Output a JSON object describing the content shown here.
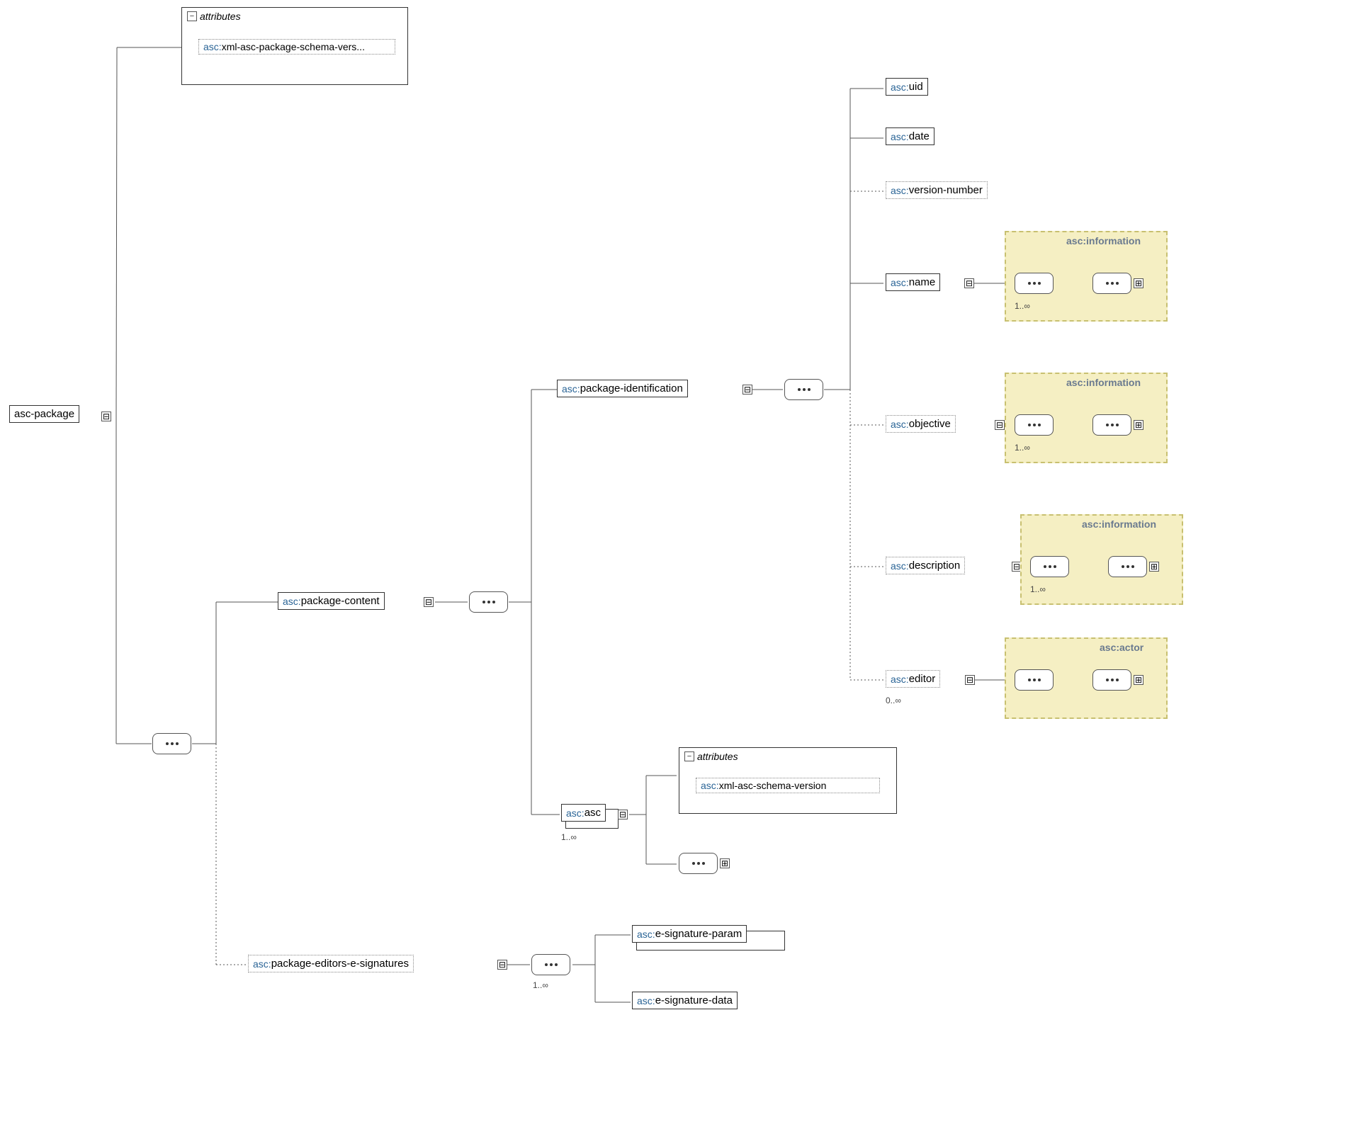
{
  "root": {
    "label": "asc-package"
  },
  "attributes1": {
    "title": "attributes",
    "item": "xml-asc-package-schema-vers...",
    "prefix": "asc:"
  },
  "packageContent": {
    "prefix": "asc:",
    "label": "package-content"
  },
  "packageEditorsESig": {
    "prefix": "asc:",
    "label": "package-editors-e-signatures"
  },
  "packageIdentification": {
    "prefix": "asc:",
    "label": "package-identification"
  },
  "ascAsc": {
    "prefix": "asc:",
    "label": "asc",
    "card": "1..∞"
  },
  "attributes2": {
    "title": "attributes",
    "item": "xml-asc-schema-version",
    "prefix": "asc:"
  },
  "eSigParam": {
    "prefix": "asc:",
    "label": "e-signature-param"
  },
  "eSigData": {
    "prefix": "asc:",
    "label": "e-signature-data"
  },
  "uid": {
    "prefix": "asc:",
    "label": "uid"
  },
  "date": {
    "prefix": "asc:",
    "label": "date"
  },
  "versionNumber": {
    "prefix": "asc:",
    "label": "version-number"
  },
  "name": {
    "prefix": "asc:",
    "label": "name"
  },
  "objective": {
    "prefix": "asc:",
    "label": "objective"
  },
  "description": {
    "prefix": "asc:",
    "label": "description"
  },
  "editor": {
    "prefix": "asc:",
    "label": "editor",
    "card": "0..∞"
  },
  "info1": {
    "label": "asc:information",
    "card": "1..∞"
  },
  "info2": {
    "label": "asc:information",
    "card": "1..∞"
  },
  "info3": {
    "label": "asc:information",
    "card": "1..∞"
  },
  "actor": {
    "label": "asc:actor"
  },
  "sigCard": "1..∞"
}
